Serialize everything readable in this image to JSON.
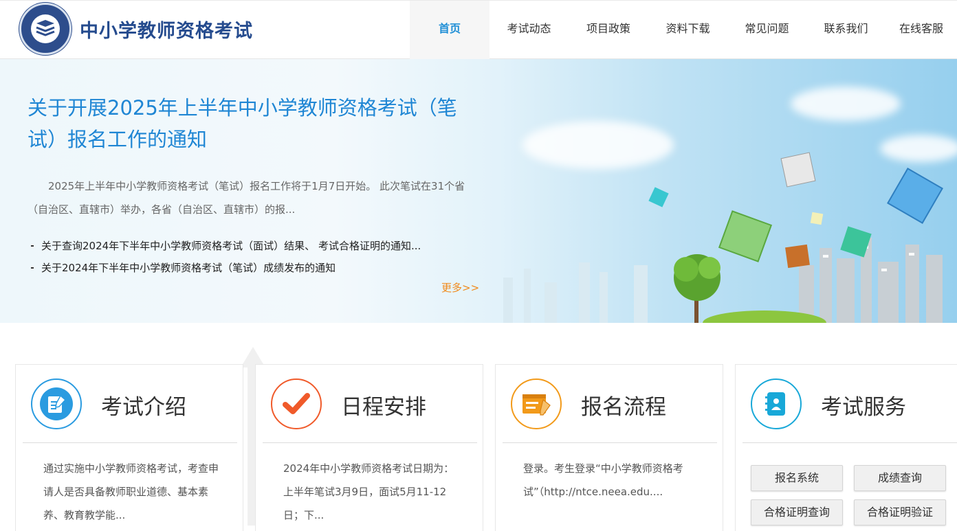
{
  "header": {
    "site_title": "中小学教师资格考试",
    "logo_icon": "book-stack-emblem"
  },
  "nav": {
    "items": [
      {
        "label": "首页",
        "active": true
      },
      {
        "label": "考试动态",
        "active": false
      },
      {
        "label": "项目政策",
        "active": false
      },
      {
        "label": "资料下载",
        "active": false
      },
      {
        "label": "常见问题",
        "active": false
      },
      {
        "label": "联系我们",
        "active": false
      },
      {
        "label": "在线客服",
        "active": false
      }
    ]
  },
  "banner": {
    "headline": "关于开展2025年上半年中小学教师资格考试（笔试）报名工作的通知",
    "summary": "2025年上半年中小学教师资格考试（笔试）报名工作将于1月7日开始。  此次笔试在31个省（自治区、直辖市）举办，各省（自治区、直辖市）的报...",
    "news": [
      "关于查询2024年下半年中小学教师资格考试（面试）结果、 考试合格证明的通知...",
      "关于2024年下半年中小学教师资格考试（笔试）成绩发布的通知"
    ],
    "more_label": "更多>>"
  },
  "cards": [
    {
      "title": "考试介绍",
      "icon": "document-edit-icon",
      "color": "#2a9be0",
      "text": "通过实施中小学教师资格考试，考查申请人是否具备教师职业道德、基本素养、教育教学能..."
    },
    {
      "title": "日程安排",
      "icon": "checkmark-icon",
      "color": "#f05a2a",
      "text": "2024年中小学教师资格考试日期为：上半年笔试3月9日，面试5月11-12日；下..."
    },
    {
      "title": "报名流程",
      "icon": "form-edit-icon",
      "color": "#f29a1a",
      "text": "登录。考生登录“中小学教师资格考试”（http://ntce.neea.edu...."
    },
    {
      "title": "考试服务",
      "icon": "contact-book-icon",
      "color": "#18a8d8",
      "buttons": [
        "报名系统",
        "成绩查询",
        "合格证明查询",
        "合格证明验证"
      ]
    }
  ],
  "colors": {
    "brand_blue": "#254b8e",
    "link_blue": "#1f86d4",
    "more_orange": "#f08a1c"
  }
}
